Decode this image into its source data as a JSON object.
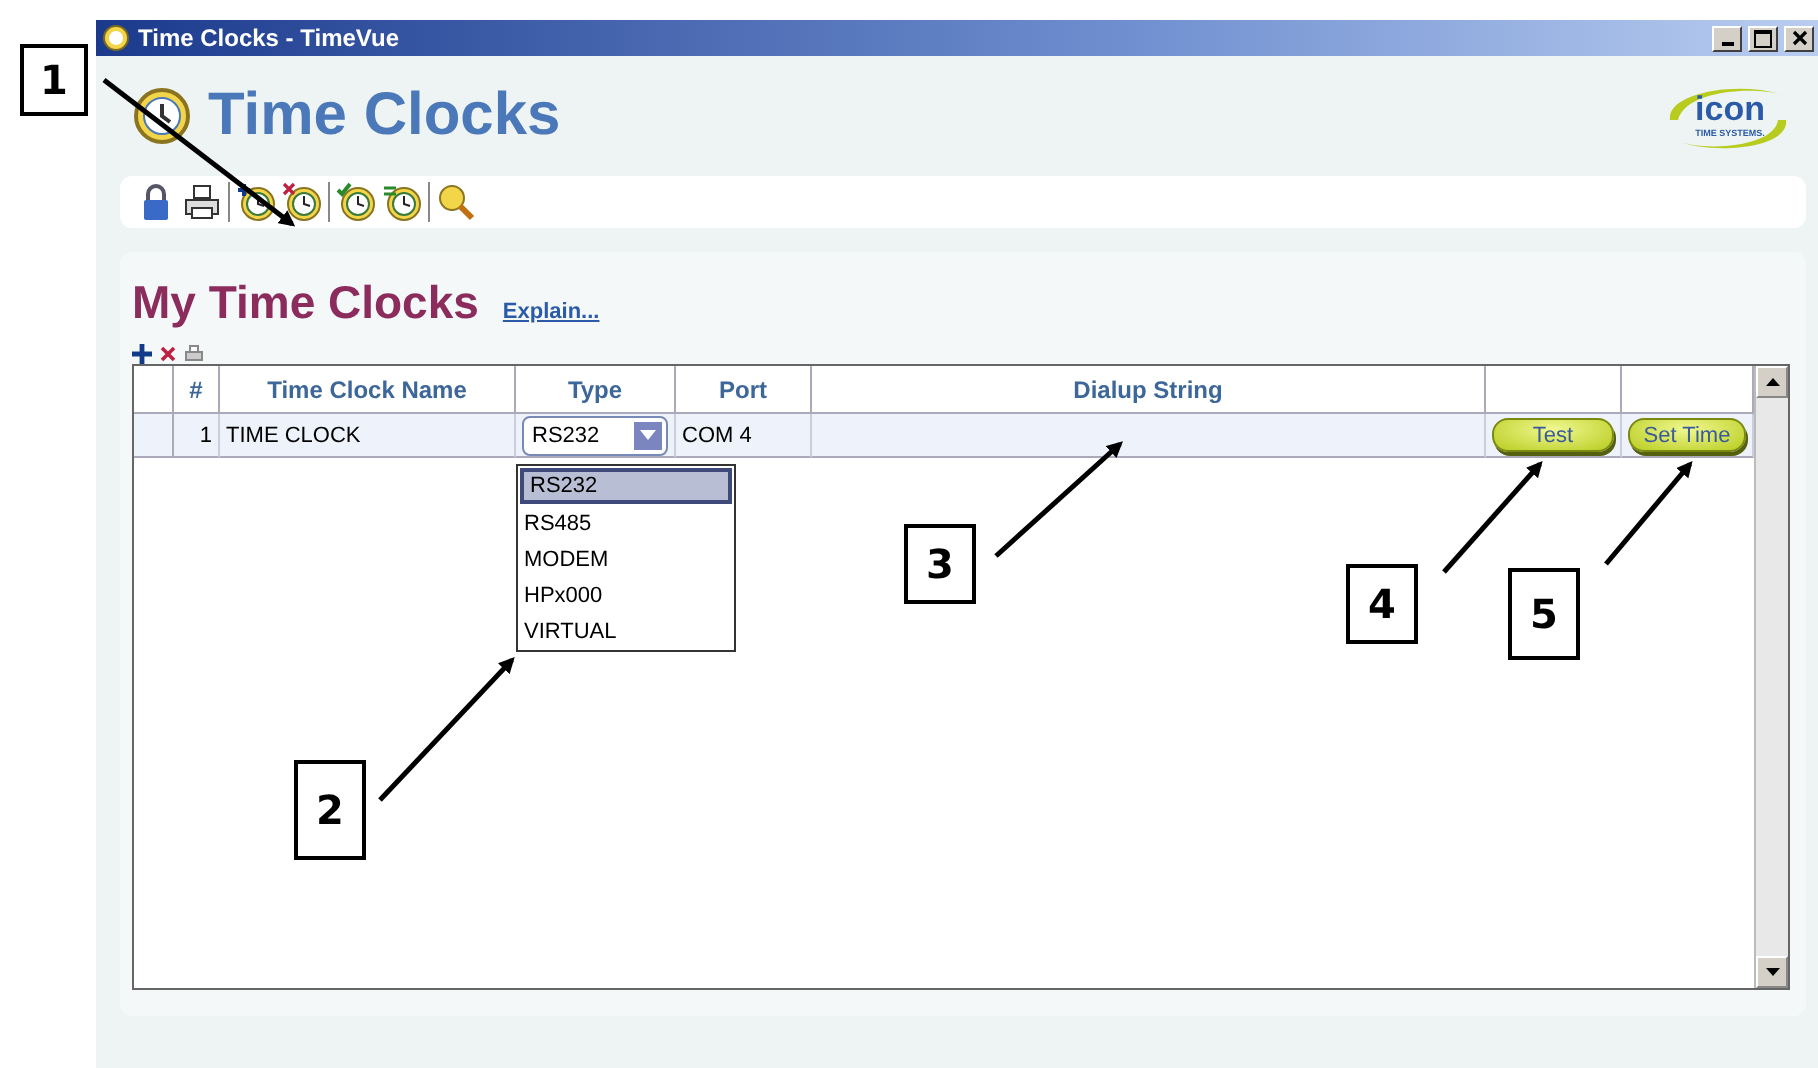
{
  "window": {
    "title": "Time Clocks - TimeVue"
  },
  "header": {
    "title": "Time Clocks",
    "logo": {
      "name": "icon",
      "tagline": "TIME SYSTEMS."
    }
  },
  "section": {
    "title": "My Time Clocks",
    "link": "Explain..."
  },
  "table": {
    "columns": [
      "#",
      "Time Clock Name",
      "Type",
      "Port",
      "Dialup String"
    ],
    "rows": [
      {
        "number": "1",
        "name": "TIME CLOCK",
        "type": "RS232",
        "port": "COM 4",
        "actions": [
          "Test",
          "Set Time"
        ]
      }
    ]
  },
  "dropdown": {
    "options": [
      {
        "label": "RS232",
        "selected": true
      },
      {
        "label": "RS485",
        "selected": false
      },
      {
        "label": "MODEM",
        "selected": false
      },
      {
        "label": "HPx000",
        "selected": false
      },
      {
        "label": "VIRTUAL",
        "selected": false
      }
    ]
  },
  "callouts": [
    {
      "label": "1"
    },
    {
      "label": "2"
    },
    {
      "label": "3"
    },
    {
      "label": "4"
    },
    {
      "label": "5"
    }
  ]
}
